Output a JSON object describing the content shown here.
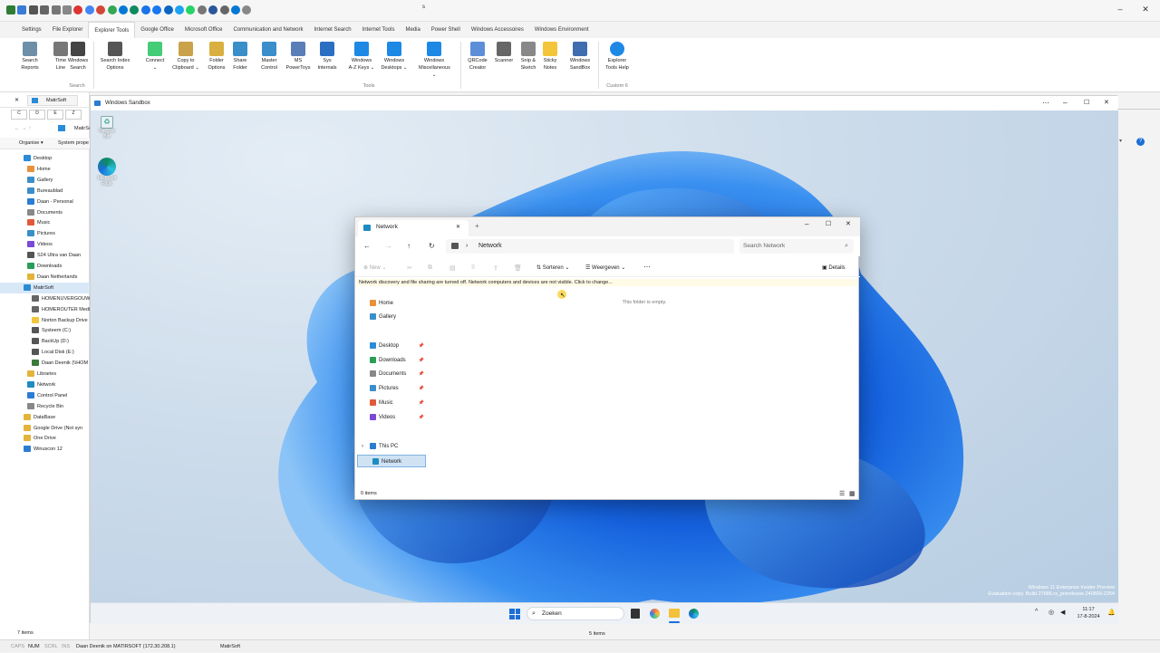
{
  "quickbar": {
    "icons": [
      "app-icon",
      "folder-icon",
      "window-icon",
      "view-icon",
      "layout-icon",
      "pin-icon",
      "browser-icon",
      "google-icon",
      "gmail-icon",
      "drive-icon",
      "store-icon",
      "edge-icon",
      "calendar-icon",
      "facebook-icon",
      "linkedin-icon",
      "twitter-icon",
      "whatsapp-icon",
      "file-icon",
      "doc-icon",
      "clip-icon",
      "cloud-icon",
      "image-icon"
    ],
    "title": "s"
  },
  "ribbon": {
    "settings": "Settings",
    "tabs": [
      "File Explorer",
      "Explorer Tools",
      "Google Office",
      "Microsoft Office",
      "Communication and Network",
      "Internet Search",
      "Internet Tools",
      "Media",
      "Power Shell",
      "Windows Accessoires",
      "Windows Environment"
    ],
    "active_tab": "Explorer Tools",
    "buttons": [
      {
        "l1": "Search",
        "l2": "Reports",
        "icon": "search-reports-icon"
      },
      {
        "l1": "Time",
        "l2": "Line",
        "icon": "timeline-icon"
      },
      {
        "l1": "Windows",
        "l2": "Search",
        "icon": "magnifier-icon"
      },
      {
        "l1": "Search Index",
        "l2": "Options",
        "icon": "binoculars-icon"
      },
      {
        "l1": "Connect",
        "l2": "⌄",
        "icon": "connect-icon"
      },
      {
        "l1": "Copy to",
        "l2": "Clipboard ⌄",
        "icon": "clipboard-icon"
      },
      {
        "l1": "Folder",
        "l2": "Options",
        "icon": "folder-options-icon"
      },
      {
        "l1": "Share",
        "l2": "Folder",
        "icon": "share-folder-icon"
      },
      {
        "l1": "Master",
        "l2": "Control",
        "icon": "master-control-icon"
      },
      {
        "l1": "MS",
        "l2": "PowerToys",
        "icon": "powertoys-icon"
      },
      {
        "l1": "Sys",
        "l2": "Internals",
        "icon": "sysinternals-icon"
      },
      {
        "l1": "Windows",
        "l2": "A-Z Keys ⌄",
        "icon": "windows-icon"
      },
      {
        "l1": "Windows",
        "l2": "Desktops ⌄",
        "icon": "windows-icon"
      },
      {
        "l1": "Windows",
        "l2": "Miscellaneous ⌄",
        "icon": "windows-icon"
      },
      {
        "l1": "QRCode",
        "l2": "Creator",
        "icon": "qrcode-icon"
      },
      {
        "l1": "Scanner",
        "l2": "",
        "icon": "scanner-icon"
      },
      {
        "l1": "Snip &",
        "l2": "Sketch",
        "icon": "snip-icon"
      },
      {
        "l1": "Sticky",
        "l2": "Notes",
        "icon": "sticky-notes-icon"
      },
      {
        "l1": "Windows",
        "l2": "SandBox",
        "icon": "sandbox-icon"
      },
      {
        "l1": "Explorer",
        "l2": "Tools Help",
        "icon": "info-icon"
      }
    ],
    "groups": [
      "Search",
      "Tools",
      "Custom 6"
    ]
  },
  "left": {
    "tab": "MatirSoft",
    "drives": [
      "C",
      "D",
      "E",
      "Z"
    ],
    "organise": "Organise ▾",
    "sysprops": "System prope",
    "path": "MatirSo",
    "tree": [
      "Desktop",
      "Home",
      "Gallery",
      "Bureaublad",
      "Daan - Personal",
      "Documents",
      "Music",
      "Pictures",
      "Videos",
      "S24 Ultra van Daan",
      "Downloads",
      "Daan Netherlands",
      "MatirSoft",
      "HOMENUVERGOUW",
      "HOMEROUTER Medi",
      "Norton Backup Drive",
      "Systeem (C:)",
      "BackUp (D:)",
      "Local Disk (E:)",
      "Daan Deenik (\\\\HOM",
      "Libraries",
      "Network",
      "Control Panel",
      "Recycle Bin",
      "DataBase",
      "Google Drive (Not syn",
      "One Drive",
      "Winuscon 12"
    ],
    "items": "7 items"
  },
  "sandbox": {
    "title": "Windows Sandbox",
    "desktop_icons": [
      {
        "label": "Recycle Bin",
        "icon": "recycle-bin-icon"
      },
      {
        "label": "Microsoft Edge",
        "icon": "edge-icon"
      }
    ],
    "watermark1": "Windows 11 Enterprise Insider Preview",
    "watermark2": "Evaluation copy. Build 27686.rs_prerelease.240809-2254",
    "search": "Zoeken",
    "time": "11:17",
    "date": "17-8-2024",
    "right_items": "5 items"
  },
  "explorer": {
    "tab": "Network",
    "path": "Network",
    "search_placeholder": "Search Network",
    "new": "New",
    "sort": "Sorteren",
    "view": "Weergeven",
    "details": "Details",
    "banner": "Network discovery and file sharing are turned off. Network computers and devices are not visible. Click to change...",
    "empty": "This folder is empty.",
    "nav": [
      "Home",
      "Gallery",
      "Desktop",
      "Downloads",
      "Documents",
      "Pictures",
      "Music",
      "Videos",
      "This PC",
      "Network"
    ],
    "status": "0 items"
  },
  "status": {
    "caps": "CAPS",
    "num": "NUM",
    "scrl": "SCRL",
    "ins": "INS",
    "user": "Daan Deenik on MATIRSOFT (172.30.208.1)",
    "folder": "MatirSoft"
  }
}
